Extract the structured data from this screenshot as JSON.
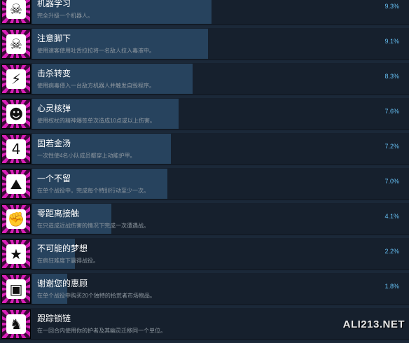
{
  "achievements": [
    {
      "title": "机器学习",
      "desc": "完全升级一个机器人。",
      "percent": "9.3%",
      "percent_value": 9.3,
      "icon": "robot-icon",
      "glyph": "☠"
    },
    {
      "title": "注意脚下",
      "desc": "使用速客使用吐舌拉拉将一名敌人拉入毒液中。",
      "percent": "9.1%",
      "percent_value": 9.1,
      "icon": "skull-crossbones-icon",
      "glyph": "☠"
    },
    {
      "title": "击杀转变",
      "desc": "使用病毒侵入一台敌方机器人并触发自毁程序。",
      "percent": "8.3%",
      "percent_value": 8.3,
      "icon": "lightning-icon",
      "glyph": "⚡"
    },
    {
      "title": "心灵核弹",
      "desc": "使用权杖的精神爆签单次造成10点或以上伤害。",
      "percent": "7.6%",
      "percent_value": 7.6,
      "icon": "hooded-figure-icon",
      "glyph": "☻"
    },
    {
      "title": "固若金汤",
      "desc": "一次性使4名小队成员都穿上动能护甲。",
      "percent": "7.2%",
      "percent_value": 7.2,
      "icon": "number-four-icon",
      "glyph": "4"
    },
    {
      "title": "一个不留",
      "desc": "在单个战役中，完成每个特别行动至少一次。",
      "percent": "7.0%",
      "percent_value": 7.0,
      "icon": "rubble-icon",
      "glyph": "⛰"
    },
    {
      "title": "零距离接触",
      "desc": "在只造成近战伤害的情况下完成一次遭遇战。",
      "percent": "4.1%",
      "percent_value": 4.1,
      "icon": "fist-icon",
      "glyph": "✊"
    },
    {
      "title": "不可能的梦想",
      "desc": "在疯狂难度下赢得战役。",
      "percent": "2.2%",
      "percent_value": 2.2,
      "icon": "head-star-icon",
      "glyph": "★"
    },
    {
      "title": "谢谢您的惠顾",
      "desc": "在单个战役中购买20个独特的拾荒者市场物品。",
      "percent": "1.8%",
      "percent_value": 1.8,
      "icon": "crate-icon",
      "glyph": "▣"
    },
    {
      "title": "跟踪锁链",
      "desc": "在一回合内使用你的护者及其幽灵迁移同一个单位。",
      "percent": "",
      "percent_value": null,
      "icon": "figure-icon",
      "glyph": "♞"
    }
  ],
  "watermark": "ALI213.NET"
}
